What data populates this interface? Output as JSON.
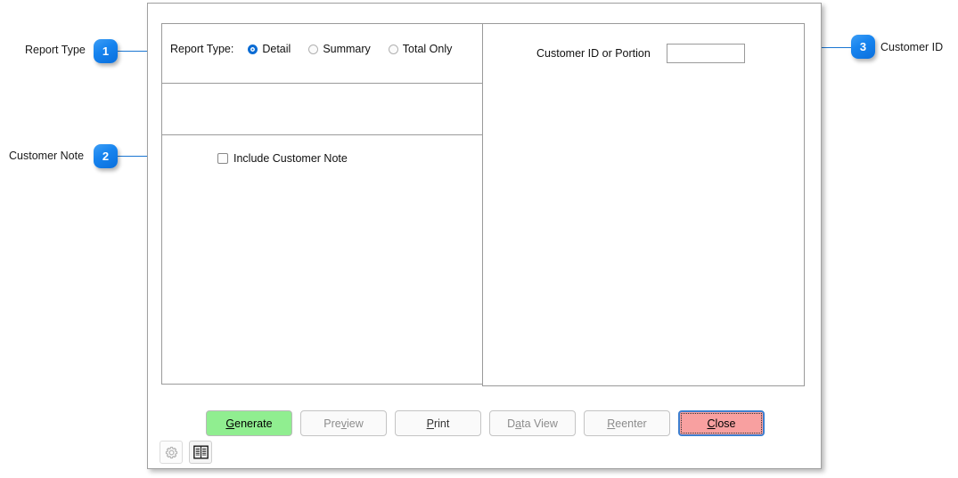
{
  "annotations": [
    {
      "number": "1",
      "label": "Report Type"
    },
    {
      "number": "2",
      "label": "Customer Note"
    },
    {
      "number": "3",
      "label": "Customer ID"
    }
  ],
  "dialog": {
    "left_panel": {
      "report_type": {
        "label": "Report Type:",
        "options": [
          {
            "label": "Detail",
            "selected": true
          },
          {
            "label": "Summary",
            "selected": false
          },
          {
            "label": "Total Only",
            "selected": false
          }
        ]
      },
      "customer_note": {
        "label": "Include Customer Note",
        "checked": false
      }
    },
    "right_panel": {
      "customer_id": {
        "label": "Customer ID or Portion",
        "value": "",
        "placeholder": ""
      }
    },
    "buttons": [
      {
        "label": "Generate",
        "accel": "G",
        "style": "primary",
        "enabled": true
      },
      {
        "label": "Preview",
        "accel": "v",
        "style": "default",
        "enabled": false
      },
      {
        "label": "Print",
        "accel": "P",
        "style": "default",
        "enabled": true
      },
      {
        "label": "Data View",
        "accel": "a",
        "style": "default",
        "enabled": false
      },
      {
        "label": "Reenter",
        "accel": "R",
        "style": "default",
        "enabled": false
      },
      {
        "label": "Close",
        "accel": "C",
        "style": "danger",
        "enabled": true
      }
    ],
    "tools": [
      {
        "icon": "gear-icon",
        "name": "settings"
      },
      {
        "icon": "book-icon",
        "name": "help-manual"
      }
    ]
  },
  "colors": {
    "accent": "#1a76d2",
    "badge": "#1784ef",
    "generate": "#90ee90",
    "close": "#f8a0a0",
    "panel_border": "#9a9a9a"
  }
}
